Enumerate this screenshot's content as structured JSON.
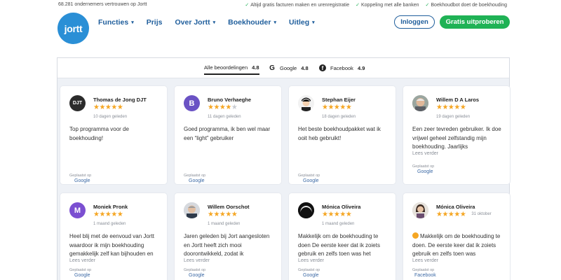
{
  "topbar": {
    "trust_text": "68.281 ondernemers vertrouwen op Jortt",
    "usps": [
      "Altijd gratis facturen maken en urenregistratie",
      "Koppeling met alle banken",
      "Boekhoudbot doet de boekhouding"
    ]
  },
  "header": {
    "logo_text": "jortt",
    "nav": [
      {
        "label": "Functies",
        "has_dropdown": true
      },
      {
        "label": "Prijs",
        "has_dropdown": false
      },
      {
        "label": "Over Jortt",
        "has_dropdown": true
      },
      {
        "label": "Boekhouder",
        "has_dropdown": true
      },
      {
        "label": "Uitleg",
        "has_dropdown": true
      }
    ],
    "login_label": "Inloggen",
    "trial_label": "Gratis uitproberen"
  },
  "reviews": {
    "tabs": [
      {
        "label": "Alle beoordelingen",
        "score": "4.8",
        "icon": "none",
        "active": true
      },
      {
        "label": "Google",
        "score": "4.8",
        "icon": "google-icon",
        "active": false
      },
      {
        "label": "Facebook",
        "score": "4.9",
        "icon": "facebook-icon",
        "active": false
      }
    ],
    "posted_label": "Geplaatst op",
    "read_more_label": "Lees verder",
    "cards": [
      {
        "name": "Thomas de Jong DJT",
        "rating": 5,
        "date": "10 dagen geleden",
        "text": "Top programma voor de boekhouding!",
        "source": "Google",
        "avatar_letter": "DJT",
        "avatar_color": "#2b2b2b",
        "read_more": false
      },
      {
        "name": "Bruno Verhaeghe",
        "rating": 4,
        "date": "11 dagen geleden",
        "text": "Goed programma, ik ben wel maar een “light” gebruiker",
        "source": "Google",
        "avatar_letter": "B",
        "avatar_color": "#6a52c4",
        "read_more": false
      },
      {
        "name": "Stephan Eijer",
        "rating": 5,
        "date": "18 dagen geleden",
        "text": "Het beste boekhoudpakket wat ik ooit heb gebruikt!",
        "source": "Google",
        "avatar_letter": "",
        "avatar_color": "#d9d9d9",
        "read_more": false
      },
      {
        "name": "Willem D A Laros",
        "rating": 5,
        "date": "19 dagen geleden",
        "text": "Een zeer tevreden gebruiker. Ik doe vrijwel geheel zelfstandig mijn boekhouding. Jaarlijks",
        "source": "Google",
        "avatar_letter": "",
        "avatar_color": "#b9a58e",
        "read_more": true
      },
      {
        "name": "Moniek Pronk",
        "rating": 5,
        "date": "1 maand geleden",
        "text": "Heel blij met de eenvoud van Jortt waardoor ik mijn boekhouding gemakkelijk zelf kan bijhouden en",
        "source": "Google",
        "avatar_letter": "M",
        "avatar_color": "#7b4fd1",
        "read_more": true
      },
      {
        "name": "Willem Oorschot",
        "rating": 5,
        "date": "1 maand geleden",
        "text": "Jaren geleden bij Jort aangesloten en Jortt heeft zich mooi doorontwikkeld, zodat ik",
        "source": "Google",
        "avatar_letter": "",
        "avatar_color": "#c8ccd2",
        "read_more": true
      },
      {
        "name": "Mónica Oliveira",
        "rating": 5,
        "date": "1 maand geleden",
        "text": "Makkelijk om de boekhouding te doen De eerste keer dat ik zoiets gebruik en zelfs toen was het",
        "source": "Google",
        "avatar_letter": "",
        "avatar_color": "#1f1f1f",
        "read_more": true
      },
      {
        "name": "Mónica Oliveira",
        "rating": 5,
        "date": "31 oktober",
        "text": "Makkelijk om de boekhouding te doen. De eerste keer dat ik zoiets gebruik en zelfs toen was",
        "source": "Facebook",
        "avatar_letter": "",
        "avatar_color": "#d8cfc4",
        "read_more": true
      }
    ]
  }
}
